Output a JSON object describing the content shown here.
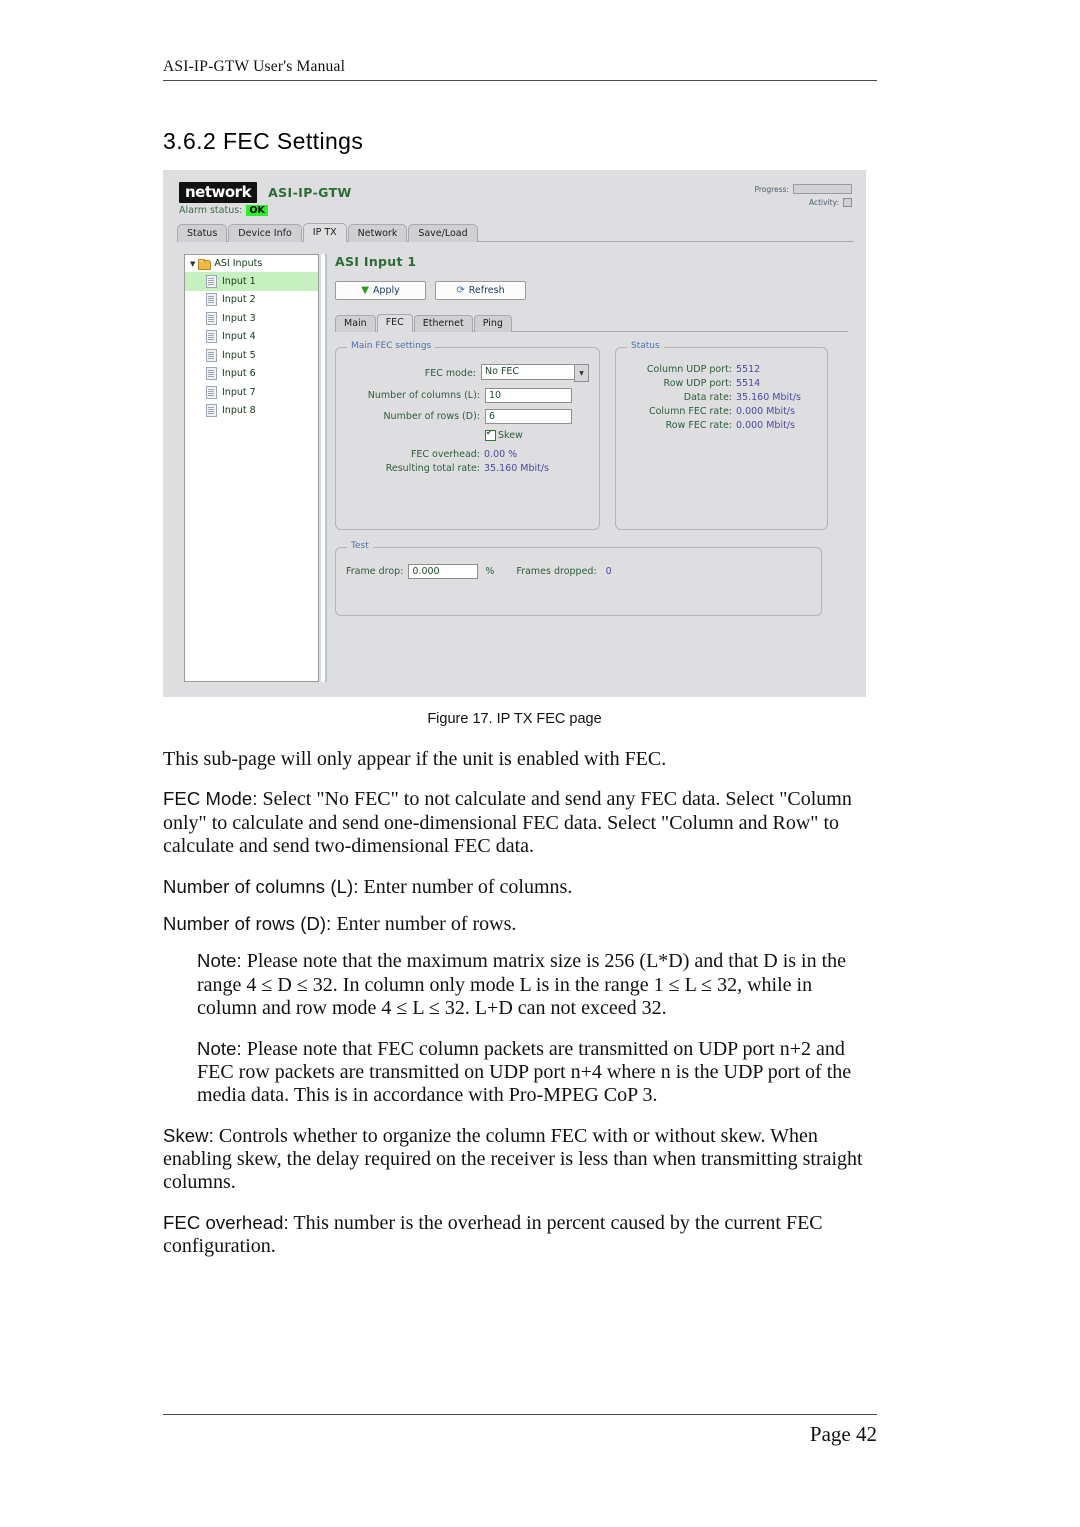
{
  "page": {
    "running_header": "ASI-IP-GTW User's Manual",
    "footer": "Page 42",
    "section_title": "3.6.2 FEC Settings",
    "figure_caption": "Figure 17. IP TX FEC page"
  },
  "screenshot": {
    "brand": {
      "logo_text": "network",
      "device_name": "ASI-IP-GTW"
    },
    "alarm": {
      "label": "Alarm status:",
      "value": "OK",
      "value_color": "#2bf02b"
    },
    "progress": {
      "progress_label": "Progress:",
      "activity_label": "Activity:"
    },
    "tabs": [
      {
        "label": "Status",
        "active": false
      },
      {
        "label": "Device Info",
        "active": false
      },
      {
        "label": "IP TX",
        "active": true
      },
      {
        "label": "Network",
        "active": false
      },
      {
        "label": "Save/Load",
        "active": false
      }
    ],
    "tree": {
      "root_label": "ASI Inputs",
      "items": [
        {
          "label": "Input 1",
          "selected": true
        },
        {
          "label": "Input 2",
          "selected": false
        },
        {
          "label": "Input 3",
          "selected": false
        },
        {
          "label": "Input 4",
          "selected": false
        },
        {
          "label": "Input 5",
          "selected": false
        },
        {
          "label": "Input 6",
          "selected": false
        },
        {
          "label": "Input 7",
          "selected": false
        },
        {
          "label": "Input 8",
          "selected": false
        }
      ]
    },
    "content": {
      "title": "ASI Input 1",
      "apply_label": "Apply",
      "refresh_label": "Refresh",
      "subtabs": [
        {
          "label": "Main",
          "active": false
        },
        {
          "label": "FEC",
          "active": true
        },
        {
          "label": "Ethernet",
          "active": false
        },
        {
          "label": "Ping",
          "active": false
        }
      ],
      "main_fec": {
        "legend": "Main FEC settings",
        "fec_mode_label": "FEC mode:",
        "fec_mode_value": "No FEC",
        "fec_mode_options": [
          "No FEC",
          "Column only",
          "Column and Row"
        ],
        "columns_label": "Number of columns (L):",
        "columns_value": "10",
        "rows_label": "Number of rows (D):",
        "rows_value": "6",
        "skew_label": "Skew",
        "skew_checked": true,
        "overhead_label": "FEC overhead:",
        "overhead_value": "0.00 %",
        "total_rate_label": "Resulting total rate:",
        "total_rate_value": "35.160 Mbit/s"
      },
      "status": {
        "legend": "Status",
        "rows": [
          {
            "label": "Column UDP port:",
            "value": "5512"
          },
          {
            "label": "Row UDP port:",
            "value": "5514"
          },
          {
            "label": "Data rate:",
            "value": "35.160 Mbit/s"
          },
          {
            "label": "Column FEC rate:",
            "value": "0.000 Mbit/s"
          },
          {
            "label": "Row FEC rate:",
            "value": "0.000 Mbit/s"
          }
        ]
      },
      "test": {
        "legend": "Test",
        "frame_drop_label": "Frame drop:",
        "frame_drop_value": "0.000",
        "percent_symbol": "%",
        "frames_dropped_label": "Frames dropped:",
        "frames_dropped_value": "0"
      }
    }
  },
  "body": {
    "p_intro": "This sub-page will only appear if the unit is enabled with FEC.",
    "p_fecmode_lead": "FEC Mode:",
    "p_fecmode_text": " Select \"No FEC\" to not calculate and send any FEC data. Select \"Column only\" to calculate and send one-dimensional FEC data. Select \"Column and Row\" to calculate and send two-dimensional FEC data.",
    "p_columns_lead": "Number of columns (L):",
    "p_columns_text": " Enter number of columns.",
    "p_rows_lead": "Number of rows (D):",
    "p_rows_text": " Enter number of rows.",
    "p_note1_lead": "Note:",
    "p_note1_text": " Please note that the maximum matrix size is 256 (L*D) and that D is in the range 4 ≤ D ≤ 32. In column only mode L is in the range 1 ≤ L ≤ 32, while in column and row mode 4 ≤ L ≤ 32. L+D can not exceed 32.",
    "p_note2_lead": "Note:",
    "p_note2_text": " Please note that FEC column packets are transmitted on UDP port n+2 and FEC row packets are transmitted on UDP port n+4 where n is the UDP port of the media data. This is in accordance with Pro-MPEG CoP 3.",
    "p_skew_lead": "Skew:",
    "p_skew_text": " Controls whether to organize the column FEC with or without skew. When enabling skew, the delay required on the receiver is less than when transmitting straight columns.",
    "p_overhead_lead": "FEC overhead:",
    "p_overhead_text": " This number is the overhead in percent caused by the current FEC configuration."
  }
}
